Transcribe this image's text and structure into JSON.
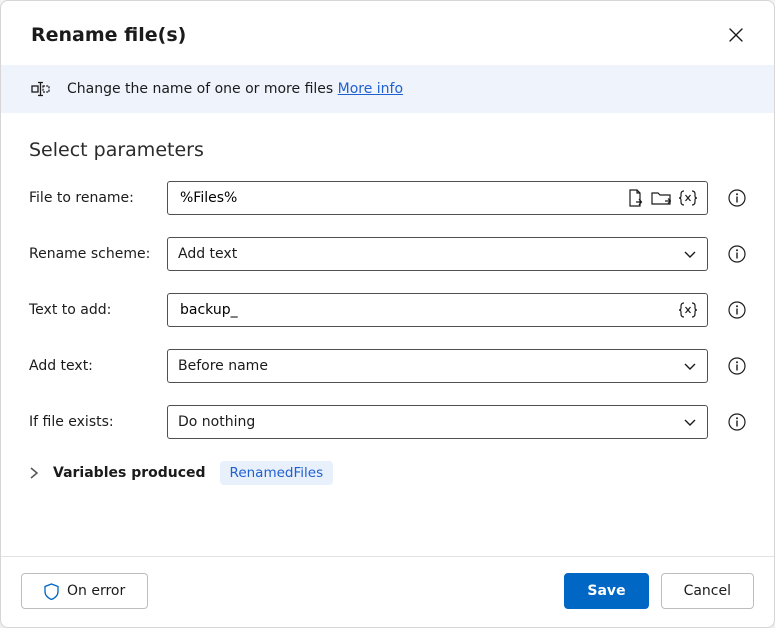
{
  "title": "Rename file(s)",
  "banner": {
    "text": "Change the name of one or more files ",
    "link_label": "More info"
  },
  "section_heading": "Select parameters",
  "fields": {
    "file_to_rename": {
      "label": "File to rename:",
      "value": "%Files%"
    },
    "rename_scheme": {
      "label": "Rename scheme:",
      "value": "Add text"
    },
    "text_to_add": {
      "label": "Text to add:",
      "value": "backup_"
    },
    "add_text": {
      "label": "Add text:",
      "value": "Before name"
    },
    "if_file_exists": {
      "label": "If file exists:",
      "value": "Do nothing"
    }
  },
  "variables": {
    "label": "Variables produced",
    "chip": "RenamedFiles"
  },
  "footer": {
    "on_error": "On error",
    "save": "Save",
    "cancel": "Cancel"
  }
}
